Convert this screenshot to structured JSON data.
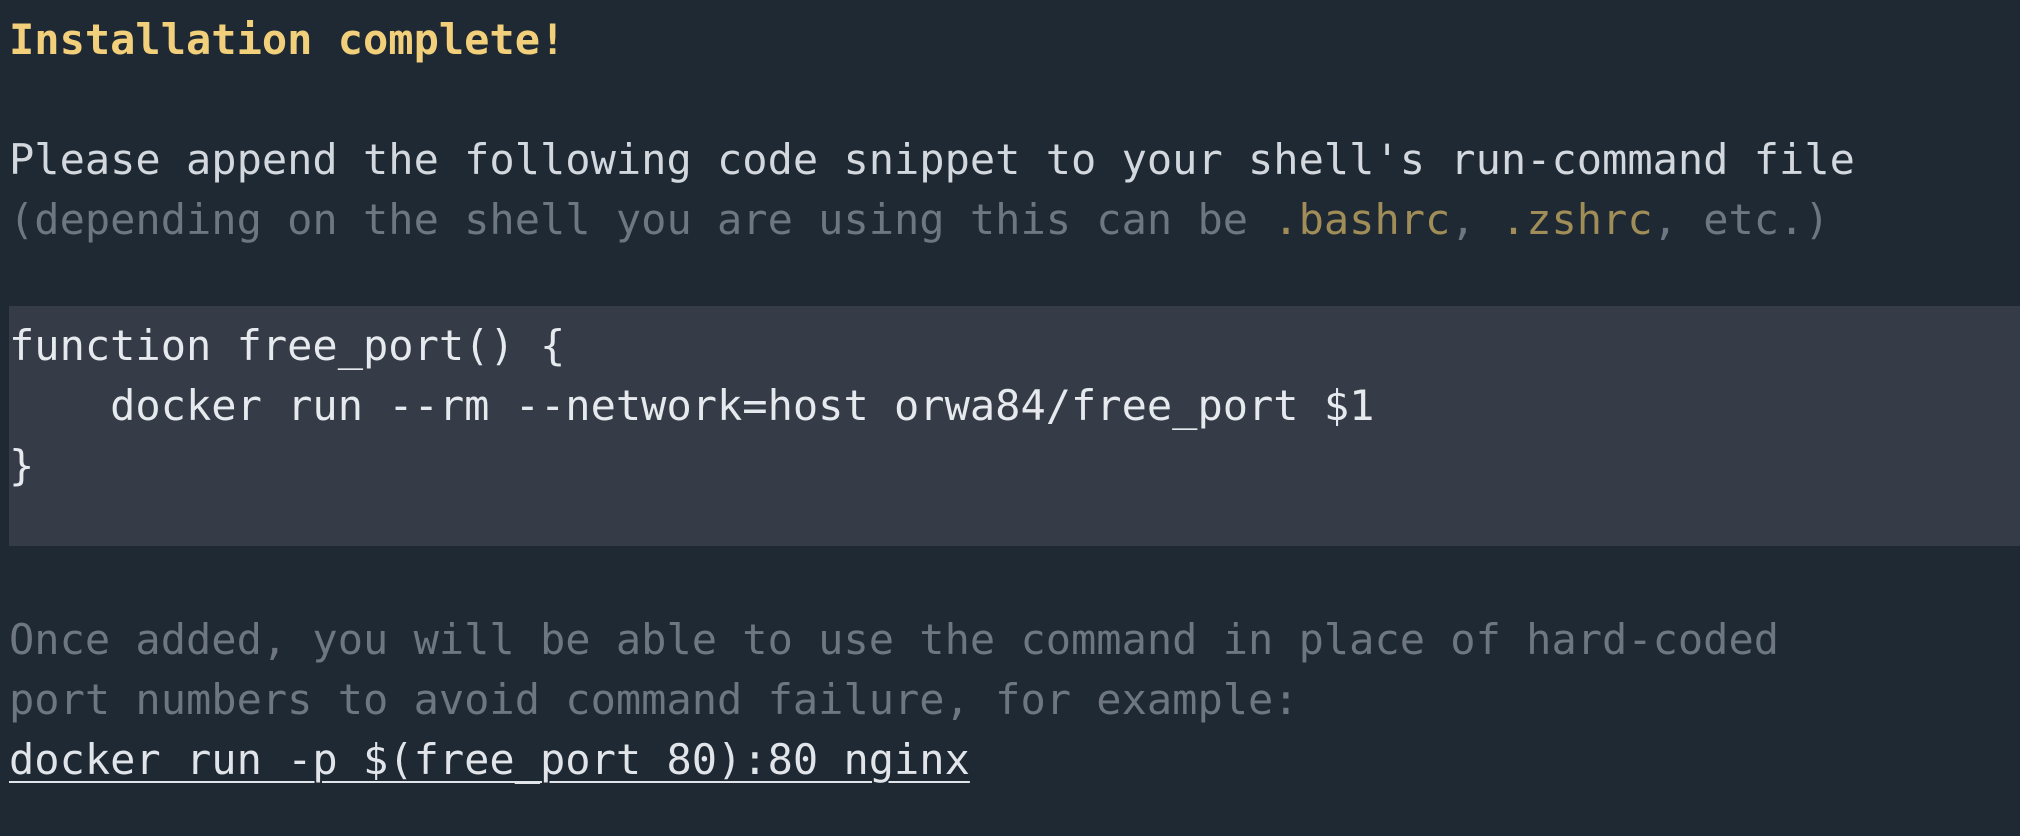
{
  "title": "Installation complete!",
  "intro": {
    "line1": "Please append the following code snippet to your shell's run-command file",
    "line2_prefix": "(depending on the shell you are using this can be ",
    "file1": ".bashrc",
    "sep": ", ",
    "file2": ".zshrc",
    "line2_suffix": ", etc.)"
  },
  "code": {
    "line1": "function free_port() {",
    "line2": "    docker run --rm --network=host orwa84/free_port $1",
    "line3": "}"
  },
  "outro": {
    "line1": "Once added, you will be able to use the command in place of hard-coded",
    "line2": "port numbers to avoid command failure, for example:"
  },
  "example_command": "docker run -p $(free_port 80):80 nginx",
  "colors": {
    "background": "#1f2933",
    "code_background": "#363c47",
    "title": "#f2cf7a",
    "muted_text": "#6d7681",
    "file_highlight": "#a08d58"
  }
}
